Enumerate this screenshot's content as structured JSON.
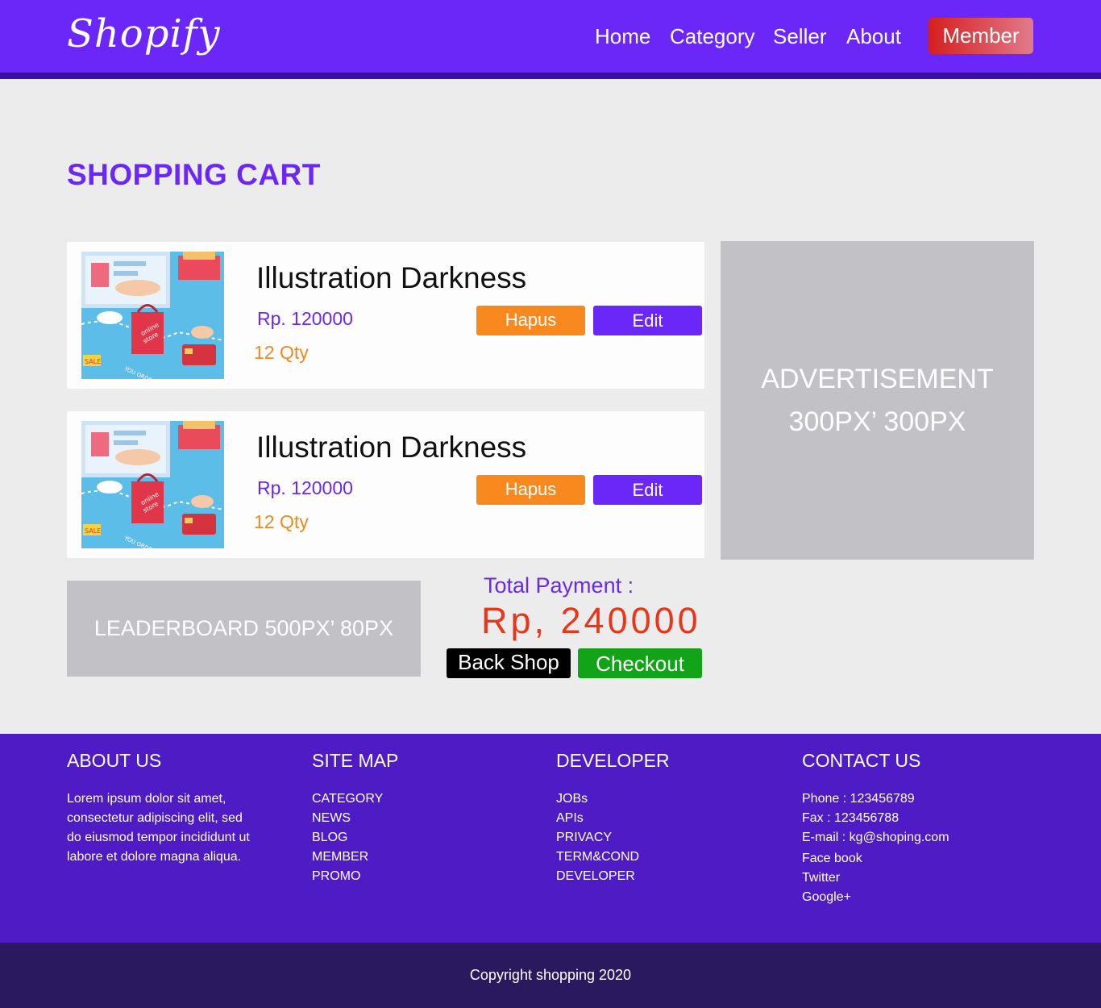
{
  "header": {
    "logo": "Shopify",
    "nav": [
      "Home",
      "Category",
      "Seller",
      "About"
    ],
    "member_label": "Member"
  },
  "page_title": "SHOPPING CART",
  "cart": {
    "items": [
      {
        "name": "Illustration Darkness",
        "price": "Rp. 120000",
        "qty": "12 Qty",
        "delete_label": "Hapus",
        "edit_label": "Edit",
        "image_text": [
          "online",
          "store",
          "SALE",
          "YOU ORDER"
        ]
      },
      {
        "name": "Illustration Darkness",
        "price": "Rp. 120000",
        "qty": "12 Qty",
        "delete_label": "Hapus",
        "edit_label": "Edit",
        "image_text": [
          "online",
          "store",
          "SALE",
          "YOU ORDER"
        ]
      }
    ],
    "total_label": "Total Payment :",
    "total_value": "Rp, 240000",
    "back_label": "Back Shop",
    "checkout_label": "Checkout"
  },
  "ads": {
    "side_line1": "ADVERTISEMENT",
    "side_line2": "300PX’ 300PX",
    "leaderboard": "LEADERBOARD 500PX’ 80PX"
  },
  "footer": {
    "about": {
      "heading": "ABOUT US",
      "text": "Lorem ipsum dolor sit amet, consectetur adipiscing elit, sed do eiusmod tempor incididunt ut labore et dolore magna aliqua."
    },
    "sitemap": {
      "heading": "SITE MAP",
      "items": [
        "CATEGORY",
        "NEWS",
        "BLOG",
        "MEMBER",
        "PROMO"
      ]
    },
    "developer": {
      "heading": "DEVELOPER",
      "items": [
        "JOBs",
        "APIs",
        "PRIVACY",
        "TERM&COND",
        "DEVELOPER"
      ]
    },
    "contact": {
      "heading": "CONTACT US",
      "items": [
        "Phone : 123456789",
        "Fax : 123456788",
        "E-mail : kg@shoping.com",
        "Face book",
        "Twitter",
        "Google+"
      ]
    },
    "copyright": "Copyright shopping 2020"
  },
  "colors": {
    "primary": "#6a27f8",
    "footer": "#4e1bc4",
    "copyright_bar": "#2a195f",
    "delete": "#f7891f",
    "checkout": "#13a319",
    "total": "#e8361b"
  }
}
